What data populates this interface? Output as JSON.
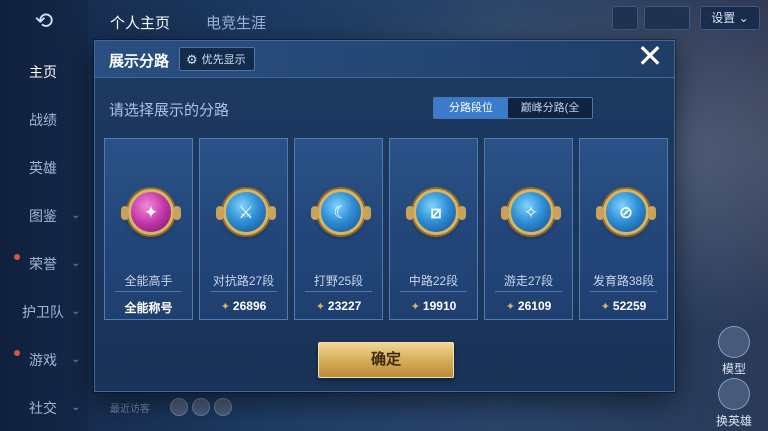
{
  "background": {
    "sidebar": {
      "items": [
        {
          "label": "主页",
          "active": true,
          "has_chevron": false
        },
        {
          "label": "战绩",
          "active": false,
          "has_chevron": false
        },
        {
          "label": "英雄",
          "active": false,
          "has_chevron": false
        },
        {
          "label": "图鉴",
          "active": false,
          "has_chevron": true
        },
        {
          "label": "荣誉",
          "active": false,
          "has_chevron": true
        },
        {
          "label": "护卫队",
          "active": false,
          "has_chevron": true
        },
        {
          "label": "游戏",
          "active": false,
          "has_chevron": true
        },
        {
          "label": "社交",
          "active": false,
          "has_chevron": true
        }
      ]
    },
    "top_tabs": [
      "个人主页",
      "电竞生涯"
    ],
    "settings_label": "设置",
    "right_buttons": [
      "模型",
      "换英雄"
    ],
    "recent_visitors_label": "最近访客"
  },
  "modal": {
    "title": "展示分路",
    "priority_button_label": "优先显示",
    "subtitle": "请选择展示的分路",
    "segmented": {
      "options": [
        "分路段位",
        "巅峰分路(全国)"
      ],
      "selected": "分路段位"
    },
    "cards": [
      {
        "label": "全能高手",
        "value": "全能称号",
        "badge_color": "#c235a8",
        "glyph": "✦",
        "value_icon": false
      },
      {
        "label": "对抗路27段",
        "value": "26896",
        "badge_color": "#2f8fd6",
        "glyph": "⚔",
        "value_icon": true
      },
      {
        "label": "打野25段",
        "value": "23227",
        "badge_color": "#2f8fd6",
        "glyph": "☾",
        "value_icon": true
      },
      {
        "label": "中路22段",
        "value": "19910",
        "badge_color": "#2f8fd6",
        "glyph": "⧄",
        "value_icon": true
      },
      {
        "label": "游走27段",
        "value": "26109",
        "badge_color": "#2f8fd6",
        "glyph": "✧",
        "value_icon": true
      },
      {
        "label": "发育路38段",
        "value": "52259",
        "badge_color": "#2f8fd6",
        "glyph": "⊘",
        "value_icon": true
      }
    ],
    "confirm_label": "确定"
  }
}
